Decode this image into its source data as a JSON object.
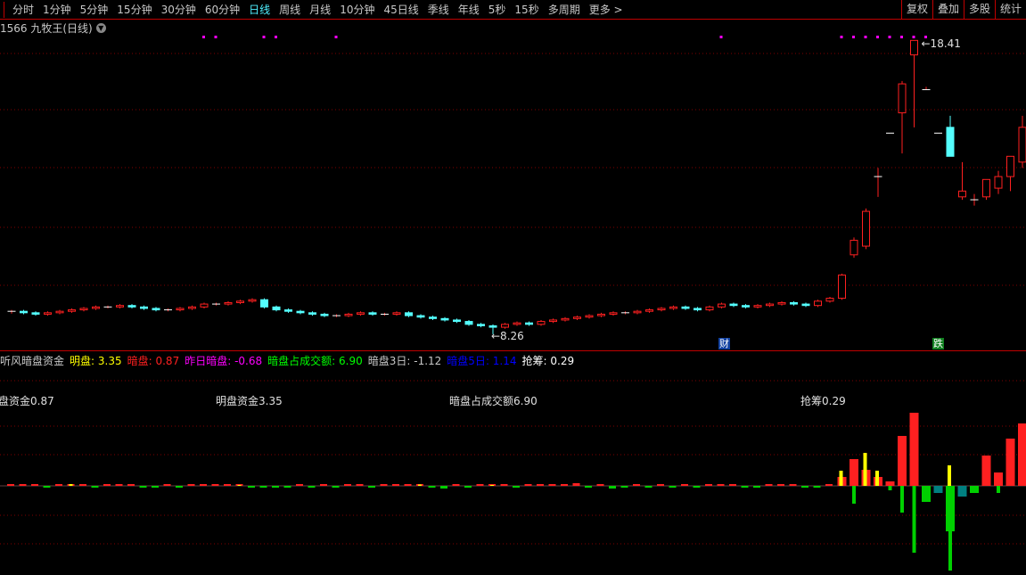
{
  "menu": {
    "items": [
      "分时",
      "1分钟",
      "5分钟",
      "15分钟",
      "30分钟",
      "60分钟",
      "日线",
      "周线",
      "月线",
      "10分钟",
      "45日线",
      "季线",
      "年线",
      "5秒",
      "15秒",
      "多周期",
      "更多 >"
    ],
    "active": "日线",
    "right": [
      "复权",
      "叠加",
      "多股",
      "统计"
    ]
  },
  "title": {
    "text": "1566 九牧王(日线)"
  },
  "price_labels": {
    "high": "18.41",
    "low": "8.26"
  },
  "markers": {
    "cai": "财",
    "die": "跌"
  },
  "legend": {
    "name": "听风暗盘资金",
    "items": [
      {
        "label": "明盘",
        "value": "3.35",
        "color": "#ffff00"
      },
      {
        "label": "暗盘",
        "value": "0.87",
        "color": "#ff2020"
      },
      {
        "label": "昨日暗盘",
        "value": "-0.68",
        "color": "#ff00ff"
      },
      {
        "label": "暗盘占成交额",
        "value": "6.90",
        "color": "#00ff00"
      },
      {
        "label": "暗盘3日",
        "value": "-1.12",
        "color": "#c8c8c8"
      },
      {
        "label": "暗盘5日",
        "value": "1.14",
        "color": "#0000ff"
      },
      {
        "label": "抢筹",
        "value": "0.29",
        "color": "#ffffff"
      }
    ]
  },
  "sub_labels": [
    "盘资金0.87",
    "明盘资金3.35",
    "暗盘占成交额6.90",
    "抢筹0.29"
  ],
  "colors": {
    "up": "#ff2020",
    "down": "#54ffff",
    "signal": "#ff00ff",
    "grid": "#800000",
    "yellow": "#ffff00",
    "green": "#00d000",
    "teal": "#008080"
  },
  "chart_data": {
    "type": "candlestick",
    "early_closes": [
      9.05,
      9.0,
      8.95,
      9.0,
      9.05,
      9.1,
      9.15,
      9.2,
      9.2,
      9.25,
      9.2,
      9.15,
      9.1,
      9.1,
      9.15,
      9.2,
      9.3,
      9.3,
      9.35,
      9.4,
      9.45,
      9.2,
      9.1,
      9.05,
      9.0,
      8.95,
      8.9,
      8.9,
      8.95,
      9.0,
      8.95,
      8.95,
      9.0,
      8.9,
      8.85,
      8.8,
      8.75,
      8.7,
      8.6,
      8.55,
      8.5,
      8.6,
      8.65,
      8.6,
      8.7,
      8.75,
      8.8,
      8.85,
      8.9,
      8.95,
      9.0,
      9.0,
      9.05,
      9.1,
      9.15,
      9.2,
      9.15,
      9.1,
      9.2,
      9.3,
      9.25,
      9.2,
      9.25,
      9.3,
      9.35,
      9.3,
      9.25,
      9.4,
      9.5
    ],
    "late_ohlc": [
      [
        9.5,
        10.35,
        9.45,
        10.3
      ],
      [
        11.0,
        11.6,
        10.9,
        11.5
      ],
      [
        11.3,
        12.6,
        11.2,
        12.5
      ],
      [
        13.7,
        14.0,
        13.0,
        13.7
      ],
      [
        15.2,
        15.2,
        15.2,
        15.2
      ],
      [
        15.9,
        17.0,
        14.5,
        16.9
      ],
      [
        17.9,
        18.41,
        15.4,
        18.4
      ],
      [
        16.7,
        16.8,
        16.7,
        16.7
      ],
      [
        15.2,
        15.2,
        15.2,
        15.2
      ],
      [
        15.4,
        15.8,
        14.4,
        14.4
      ],
      [
        13.0,
        14.2,
        12.9,
        13.2
      ],
      [
        12.9,
        13.1,
        12.7,
        12.9
      ],
      [
        13.0,
        13.6,
        12.9,
        13.6
      ],
      [
        13.3,
        13.9,
        13.1,
        13.7
      ],
      [
        13.7,
        14.4,
        13.2,
        14.4
      ],
      [
        14.2,
        15.8,
        14.0,
        15.4
      ]
    ],
    "low_point": {
      "index": 40,
      "value": 8.26
    },
    "high_point": {
      "index": 75,
      "value": 18.41
    },
    "signal_indices": [
      16,
      17,
      21,
      22,
      27,
      59,
      69,
      70,
      71,
      72,
      73,
      74,
      75,
      76
    ],
    "indicator": {
      "an": [
        0.1,
        0.1,
        0.15,
        -0.1,
        0.1,
        0.2,
        0.1,
        -0.1,
        0.1,
        0.1,
        0.15,
        -0.1,
        -0.15,
        0.1,
        -0.1,
        0.1,
        0.15,
        0.1,
        0.1,
        0.1,
        -0.1,
        -0.2,
        -0.15,
        -0.1,
        0.1,
        -0.1,
        0.1,
        -0.1,
        0.1,
        0.1,
        -0.1,
        0.1,
        0.1,
        0.15,
        0.1,
        -0.1,
        -0.3,
        0.1,
        -0.2,
        0.1,
        0.1,
        0.1,
        -0.1,
        0.1,
        0.15,
        0.1,
        0.2,
        0.3,
        -0.2,
        0.1,
        -0.3,
        -0.1,
        0.1,
        -0.1,
        0.1,
        -0.15,
        0.1,
        -0.1,
        0.1,
        0.1,
        0.1,
        -0.2,
        -0.1,
        0.1,
        0.15,
        0.1,
        -0.1,
        -0.2,
        0.1,
        1.0,
        3.0,
        1.8,
        1.0,
        0.5,
        5.6,
        8.2,
        -1.8,
        -0.8,
        -5.1,
        -1.2,
        -0.8,
        3.4,
        1.5,
        5.3,
        7.0
      ],
      "ming": [
        0,
        0,
        0,
        0,
        0,
        0.2,
        0,
        0,
        0,
        0,
        0,
        0,
        0,
        0,
        0,
        0,
        0,
        0,
        0,
        0.1,
        0,
        0,
        0,
        0,
        0,
        0,
        0,
        0,
        0,
        0,
        0,
        0,
        0,
        0,
        0.15,
        0,
        0,
        0,
        0,
        0,
        0.1,
        0,
        0,
        0,
        0,
        0,
        0,
        0,
        0,
        0,
        0,
        0,
        0,
        0,
        0,
        0,
        0,
        0,
        0,
        0,
        0,
        0,
        0,
        0,
        0,
        0,
        0,
        0,
        0,
        1.7,
        0,
        3.7,
        1.7,
        0,
        0,
        0,
        0,
        0,
        2.3,
        0,
        0,
        0,
        0,
        0,
        0,
        0
      ],
      "neg": [
        0,
        0,
        0,
        0,
        0,
        0,
        0,
        0,
        0,
        0,
        0,
        0,
        0,
        0,
        0,
        0,
        0,
        0,
        0,
        0,
        0,
        0,
        0,
        0,
        0,
        0,
        0,
        0,
        0,
        0,
        0,
        0,
        0,
        0,
        0,
        0,
        0,
        0,
        0,
        0,
        0,
        0,
        0,
        0,
        0,
        0,
        0,
        0,
        0,
        0,
        0,
        0,
        0,
        0,
        0,
        0,
        0,
        0,
        0,
        0,
        0,
        0,
        0,
        0,
        0,
        0,
        0,
        0,
        0,
        0,
        -2.0,
        0,
        0,
        -0.5,
        -3.0,
        -7.5,
        0,
        0,
        -9.5,
        0,
        0,
        0,
        -0.8,
        0,
        0
      ]
    }
  }
}
